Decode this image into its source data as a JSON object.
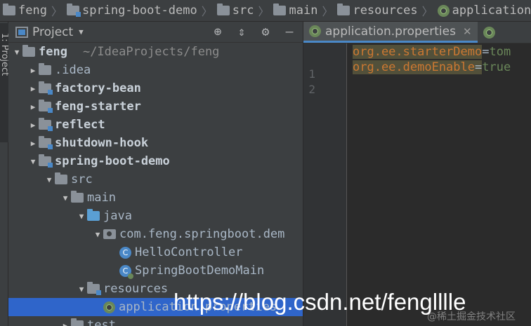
{
  "breadcrumb": [
    "feng",
    "spring-boot-demo",
    "src",
    "main",
    "resources",
    "application."
  ],
  "left_stripe": {
    "label": "1: Project"
  },
  "project_panel": {
    "title": "Project",
    "tools": [
      "locate-icon",
      "collapse-icon",
      "gear-icon",
      "minimize-icon"
    ]
  },
  "tree": [
    {
      "name": "feng",
      "path": "~/IdeaProjects/feng",
      "depth": 0,
      "arrow": "expanded",
      "icon": "folder-icon",
      "module": true
    },
    {
      "name": ".idea",
      "depth": 1,
      "arrow": "collapsed",
      "icon": "folder-icon"
    },
    {
      "name": "factory-bean",
      "depth": 1,
      "arrow": "collapsed",
      "icon": "module-folder-icon",
      "module": true
    },
    {
      "name": "feng-starter",
      "depth": 1,
      "arrow": "collapsed",
      "icon": "module-folder-icon",
      "module": true
    },
    {
      "name": "reflect",
      "depth": 1,
      "arrow": "collapsed",
      "icon": "module-folder-icon",
      "module": true
    },
    {
      "name": "shutdown-hook",
      "depth": 1,
      "arrow": "collapsed",
      "icon": "module-folder-icon",
      "module": true
    },
    {
      "name": "spring-boot-demo",
      "depth": 1,
      "arrow": "expanded",
      "icon": "module-folder-icon",
      "module": true
    },
    {
      "name": "src",
      "depth": 2,
      "arrow": "expanded",
      "icon": "folder-icon"
    },
    {
      "name": "main",
      "depth": 3,
      "arrow": "expanded",
      "icon": "folder-icon"
    },
    {
      "name": "java",
      "depth": 4,
      "arrow": "expanded",
      "icon": "source-folder-icon"
    },
    {
      "name": "com.feng.springboot.dem",
      "depth": 5,
      "arrow": "expanded",
      "icon": "package-icon"
    },
    {
      "name": "HelloController",
      "depth": 6,
      "arrow": "none",
      "icon": "class-icon"
    },
    {
      "name": "SpringBootDemoMain",
      "depth": 6,
      "arrow": "none",
      "icon": "spring-main-class-icon"
    },
    {
      "name": "resources",
      "depth": 4,
      "arrow": "expanded",
      "icon": "resources-folder-icon"
    },
    {
      "name": "application.properties",
      "depth": 5,
      "arrow": "none",
      "icon": "spring-properties-icon",
      "selected": true
    },
    {
      "name": "test",
      "depth": 3,
      "arrow": "collapsed",
      "icon": "folder-icon"
    }
  ],
  "editor": {
    "tabs": [
      {
        "label": "application.properties",
        "active": true,
        "closable": true
      },
      {
        "label": "",
        "active": false,
        "closable": false
      }
    ],
    "lines": [
      {
        "number": "1",
        "key": "org.ee.starterDemo",
        "value": "tom"
      },
      {
        "number": "2",
        "key": "org.ee.demoEnable",
        "value": "true"
      }
    ]
  },
  "watermarks": {
    "main": "https://blog.csdn.net/fenglllle",
    "small": "@稀土掘金技术社区"
  },
  "colors": {
    "panel_bg": "#3c3f41",
    "editor_bg": "#2b2b2b",
    "selection": "#2f65ca",
    "key": "#cc7832",
    "value": "#6a8759",
    "tab_underline": "#4a88c7"
  }
}
